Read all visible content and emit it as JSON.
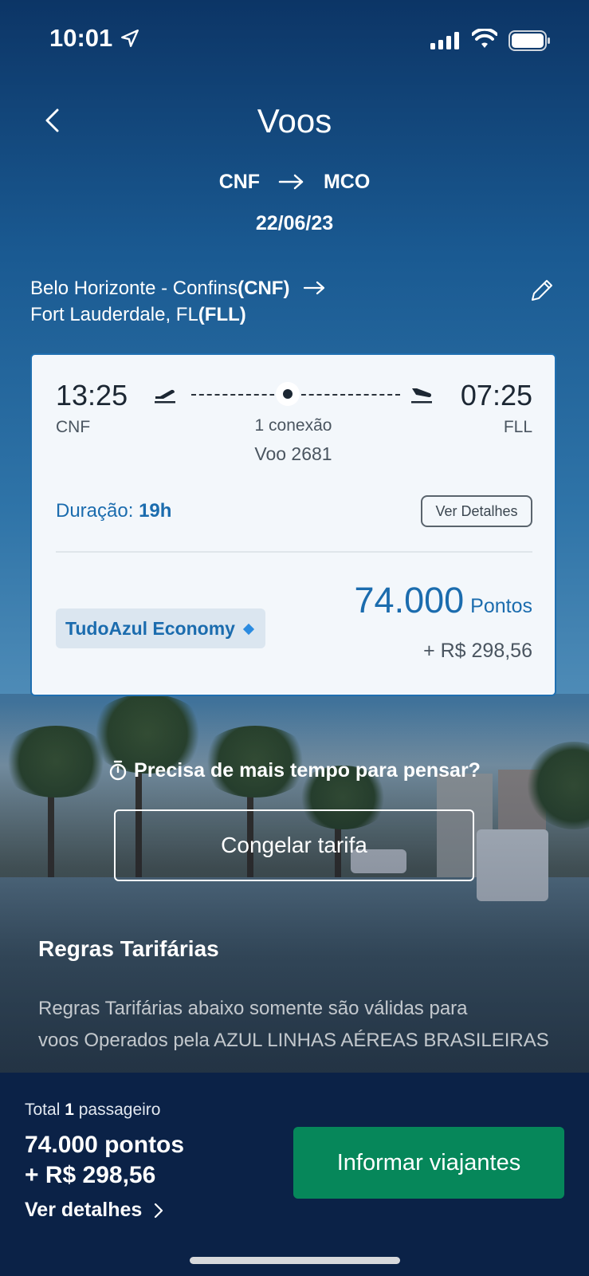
{
  "status_bar": {
    "time": "10:01"
  },
  "header": {
    "title": "Voos",
    "origin": "CNF",
    "destination": "MCO",
    "date": "22/06/23"
  },
  "itinerary": {
    "from_city": "Belo Horizonte - Confins",
    "from_code": "(CNF)",
    "to_city": "Fort Lauderdale, FL",
    "to_code": "(FLL)"
  },
  "flight_card": {
    "departure_time": "13:25",
    "departure_code": "CNF",
    "arrival_time": "07:25",
    "arrival_code": "FLL",
    "connections": "1 conexão",
    "flight_number": "Voo 2681",
    "duration_label": "Duração:",
    "duration_value": "19h",
    "details_button": "Ver Detalhes",
    "fare_family": "TudoAzul Economy",
    "points": "74.000",
    "points_unit": "Pontos",
    "cash": "+ R$ 298,56"
  },
  "freeze": {
    "question": "Precisa de mais tempo para pensar?",
    "button": "Congelar tarifa"
  },
  "rules": {
    "title": "Regras Tarifárias",
    "line1": "Regras Tarifárias abaixo somente são válidas para",
    "line2": "voos Operados pela AZUL LINHAS AÉREAS BRASILEIRAS"
  },
  "footer": {
    "total_label": "Total",
    "passenger_count": "1",
    "passenger_label": "passageiro",
    "points_total": "74.000 pontos",
    "cash_total": "+ R$ 298,56",
    "see_details": "Ver detalhes",
    "cta": "Informar viajantes"
  },
  "colors": {
    "brand_blue": "#1b6cae",
    "cta_green": "#06875a",
    "footer_bg": "#0b2247"
  }
}
